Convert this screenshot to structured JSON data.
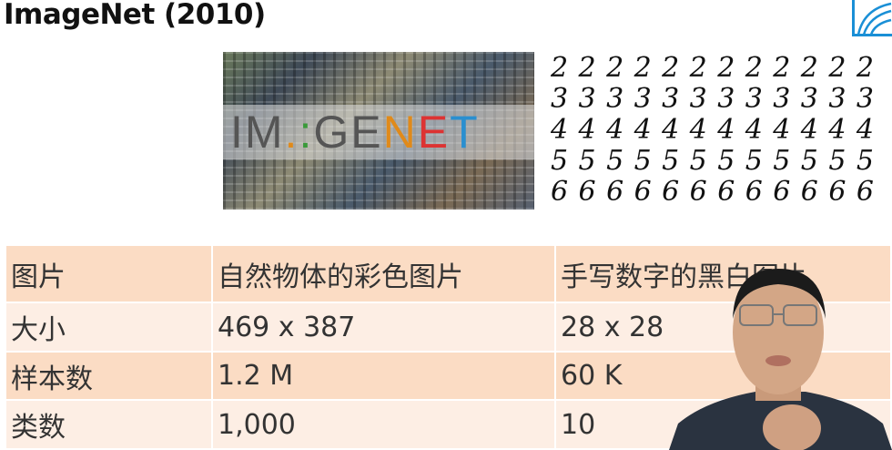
{
  "slide": {
    "title": "ImageNet (2010)",
    "imagenet_logo": "IM GENET",
    "mnist_digits": [
      "222222222222",
      "333333333333",
      "444444444444",
      "555555555555",
      "666666666666"
    ]
  },
  "table": {
    "rows": [
      [
        "图片",
        "自然物体的彩色图片",
        "手写数字的黑白图片"
      ],
      [
        "大小",
        "469 x 387",
        "28 x 28"
      ],
      [
        "样本数",
        "1.2 M",
        "60 K"
      ],
      [
        "类数",
        "1,000",
        "10"
      ]
    ]
  },
  "colors": {
    "header_row": "#fbdcc4",
    "light_row": "#fdeee4",
    "logo_blue": "#1a8fd6"
  }
}
